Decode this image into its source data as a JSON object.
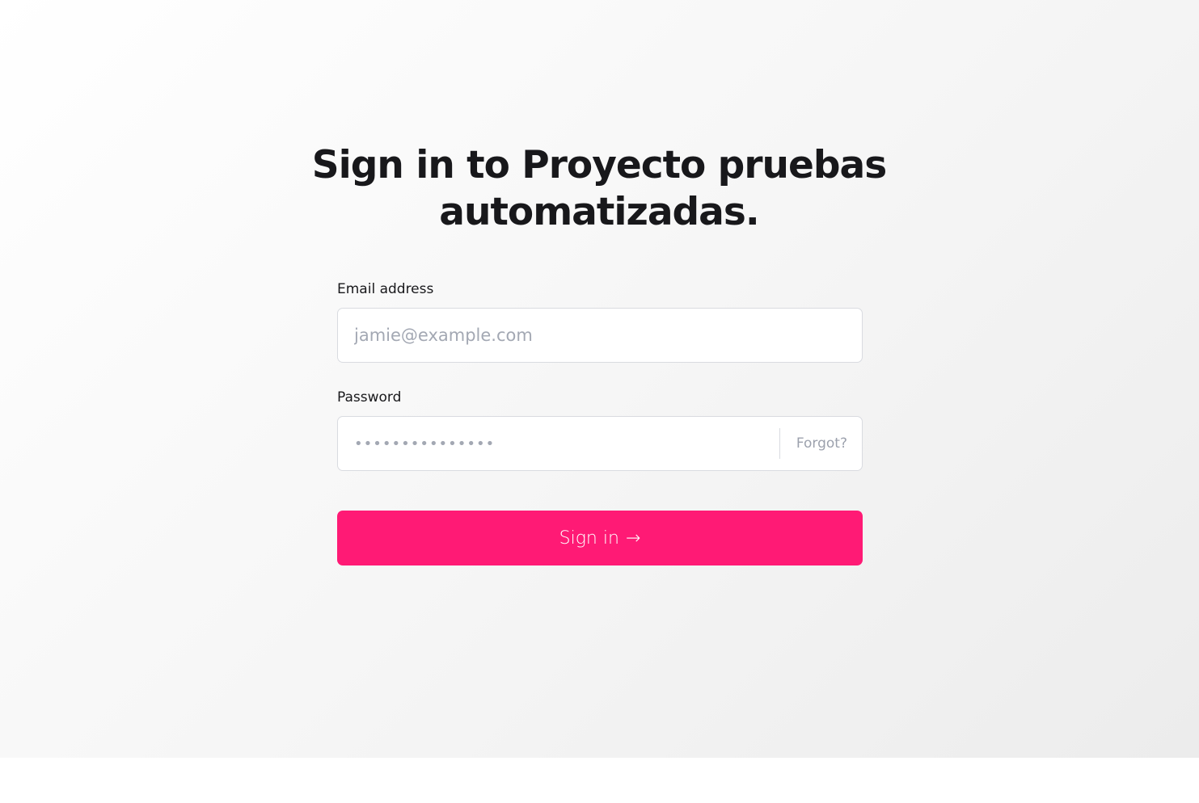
{
  "signin": {
    "title": "Sign in to Proyecto pruebas automatizadas.",
    "email": {
      "label": "Email address",
      "placeholder": "jamie@example.com",
      "value": ""
    },
    "password": {
      "label": "Password",
      "placeholder": "•••••••••••••••",
      "value": "",
      "forgot_label": "Forgot?"
    },
    "submit": {
      "label": "Sign in",
      "icon": "→",
      "icon_name": "arrow-right-icon"
    }
  },
  "colors": {
    "accent": "#ff1a75",
    "text": "#18181b",
    "muted": "#9ca1ad",
    "border": "#d9dbe0"
  }
}
